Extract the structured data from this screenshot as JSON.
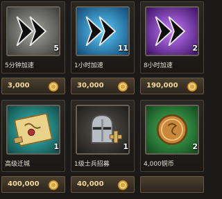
{
  "items": [
    {
      "icon": "speedup-arrow-gray-icon",
      "name": "5分钟加速",
      "qty": "5",
      "price": "3,000"
    },
    {
      "icon": "speedup-arrow-blue-icon",
      "name": "1小时加速",
      "qty": "11",
      "price": "30,000"
    },
    {
      "icon": "speedup-arrow-purple-icon",
      "name": "8小时加速",
      "qty": "2",
      "price": "190,000"
    },
    {
      "icon": "scroll-map-icon",
      "name": "高级迁城",
      "qty": "1",
      "price": "400,000"
    },
    {
      "icon": "knight-helmet-plus-icon",
      "name": "1级士兵招募",
      "qty": "1",
      "price": "40,000"
    },
    {
      "icon": "green-coin-icon",
      "name": "4,000铜币",
      "qty": "2",
      "price": ""
    }
  ],
  "colors": {
    "background": "#1c1a18",
    "price_text": "#f2d89a",
    "gray_tile": "#8a8a86",
    "blue_tile": "#2aa6e0",
    "purple_tile": "#9b48d6"
  }
}
